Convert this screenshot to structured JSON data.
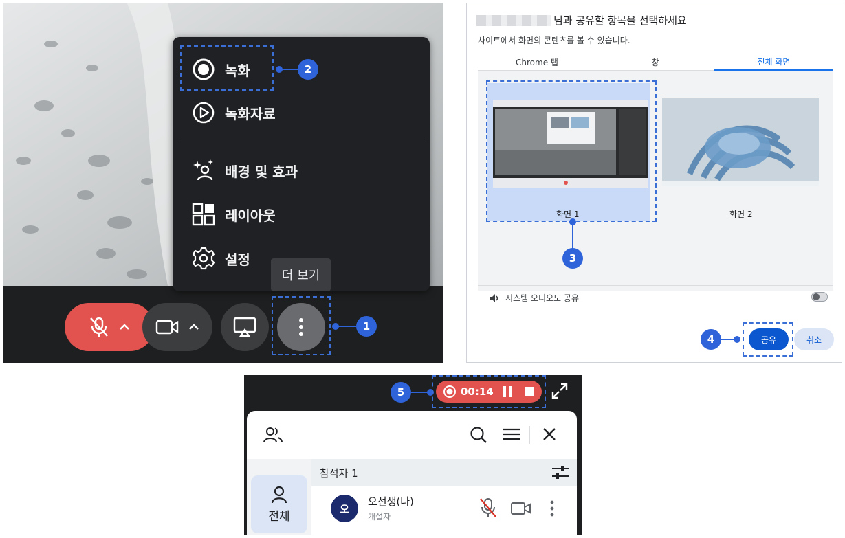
{
  "meeting": {
    "menu": {
      "record": "녹화",
      "recordings": "녹화자료",
      "effects": "배경 및 효과",
      "layout": "레이아웃",
      "settings": "설정"
    },
    "tooltip": "더 보기"
  },
  "share_dialog": {
    "title": "님과 공유할 항목을 선택하세요",
    "subtitle": "사이트에서 화면의 콘텐츠를 볼 수 있습니다.",
    "tabs": [
      "Chrome 탭",
      "창",
      "전체 화면"
    ],
    "screens": [
      "화면 1",
      "화면 2"
    ],
    "audio_label": "시스템 오디오도 공유",
    "share_label": "공유",
    "cancel_label": "취소"
  },
  "recording": {
    "timer": "00:14"
  },
  "participants": {
    "all_tab_label": "전체",
    "count_label": "참석자 1",
    "person": {
      "initial": "오",
      "name": "오선생(나)",
      "role": "개설자"
    }
  },
  "callouts": [
    "1",
    "2",
    "3",
    "4",
    "5"
  ],
  "colors": {
    "mic_muted": "#e2534f",
    "callout": "#2f63d9",
    "share_primary": "#0b57d0",
    "control_bar": "#1e1f20",
    "menu_bg": "#202124"
  },
  "icons": {
    "mic": "mic-off-icon",
    "camera": "camera-icon",
    "present": "present-screen-icon",
    "more": "more-vert-icon",
    "record": "record-icon",
    "recordings": "play-circle-icon",
    "effects": "sparkle-person-icon",
    "layout": "layout-grid-icon",
    "settings": "gear-icon"
  }
}
